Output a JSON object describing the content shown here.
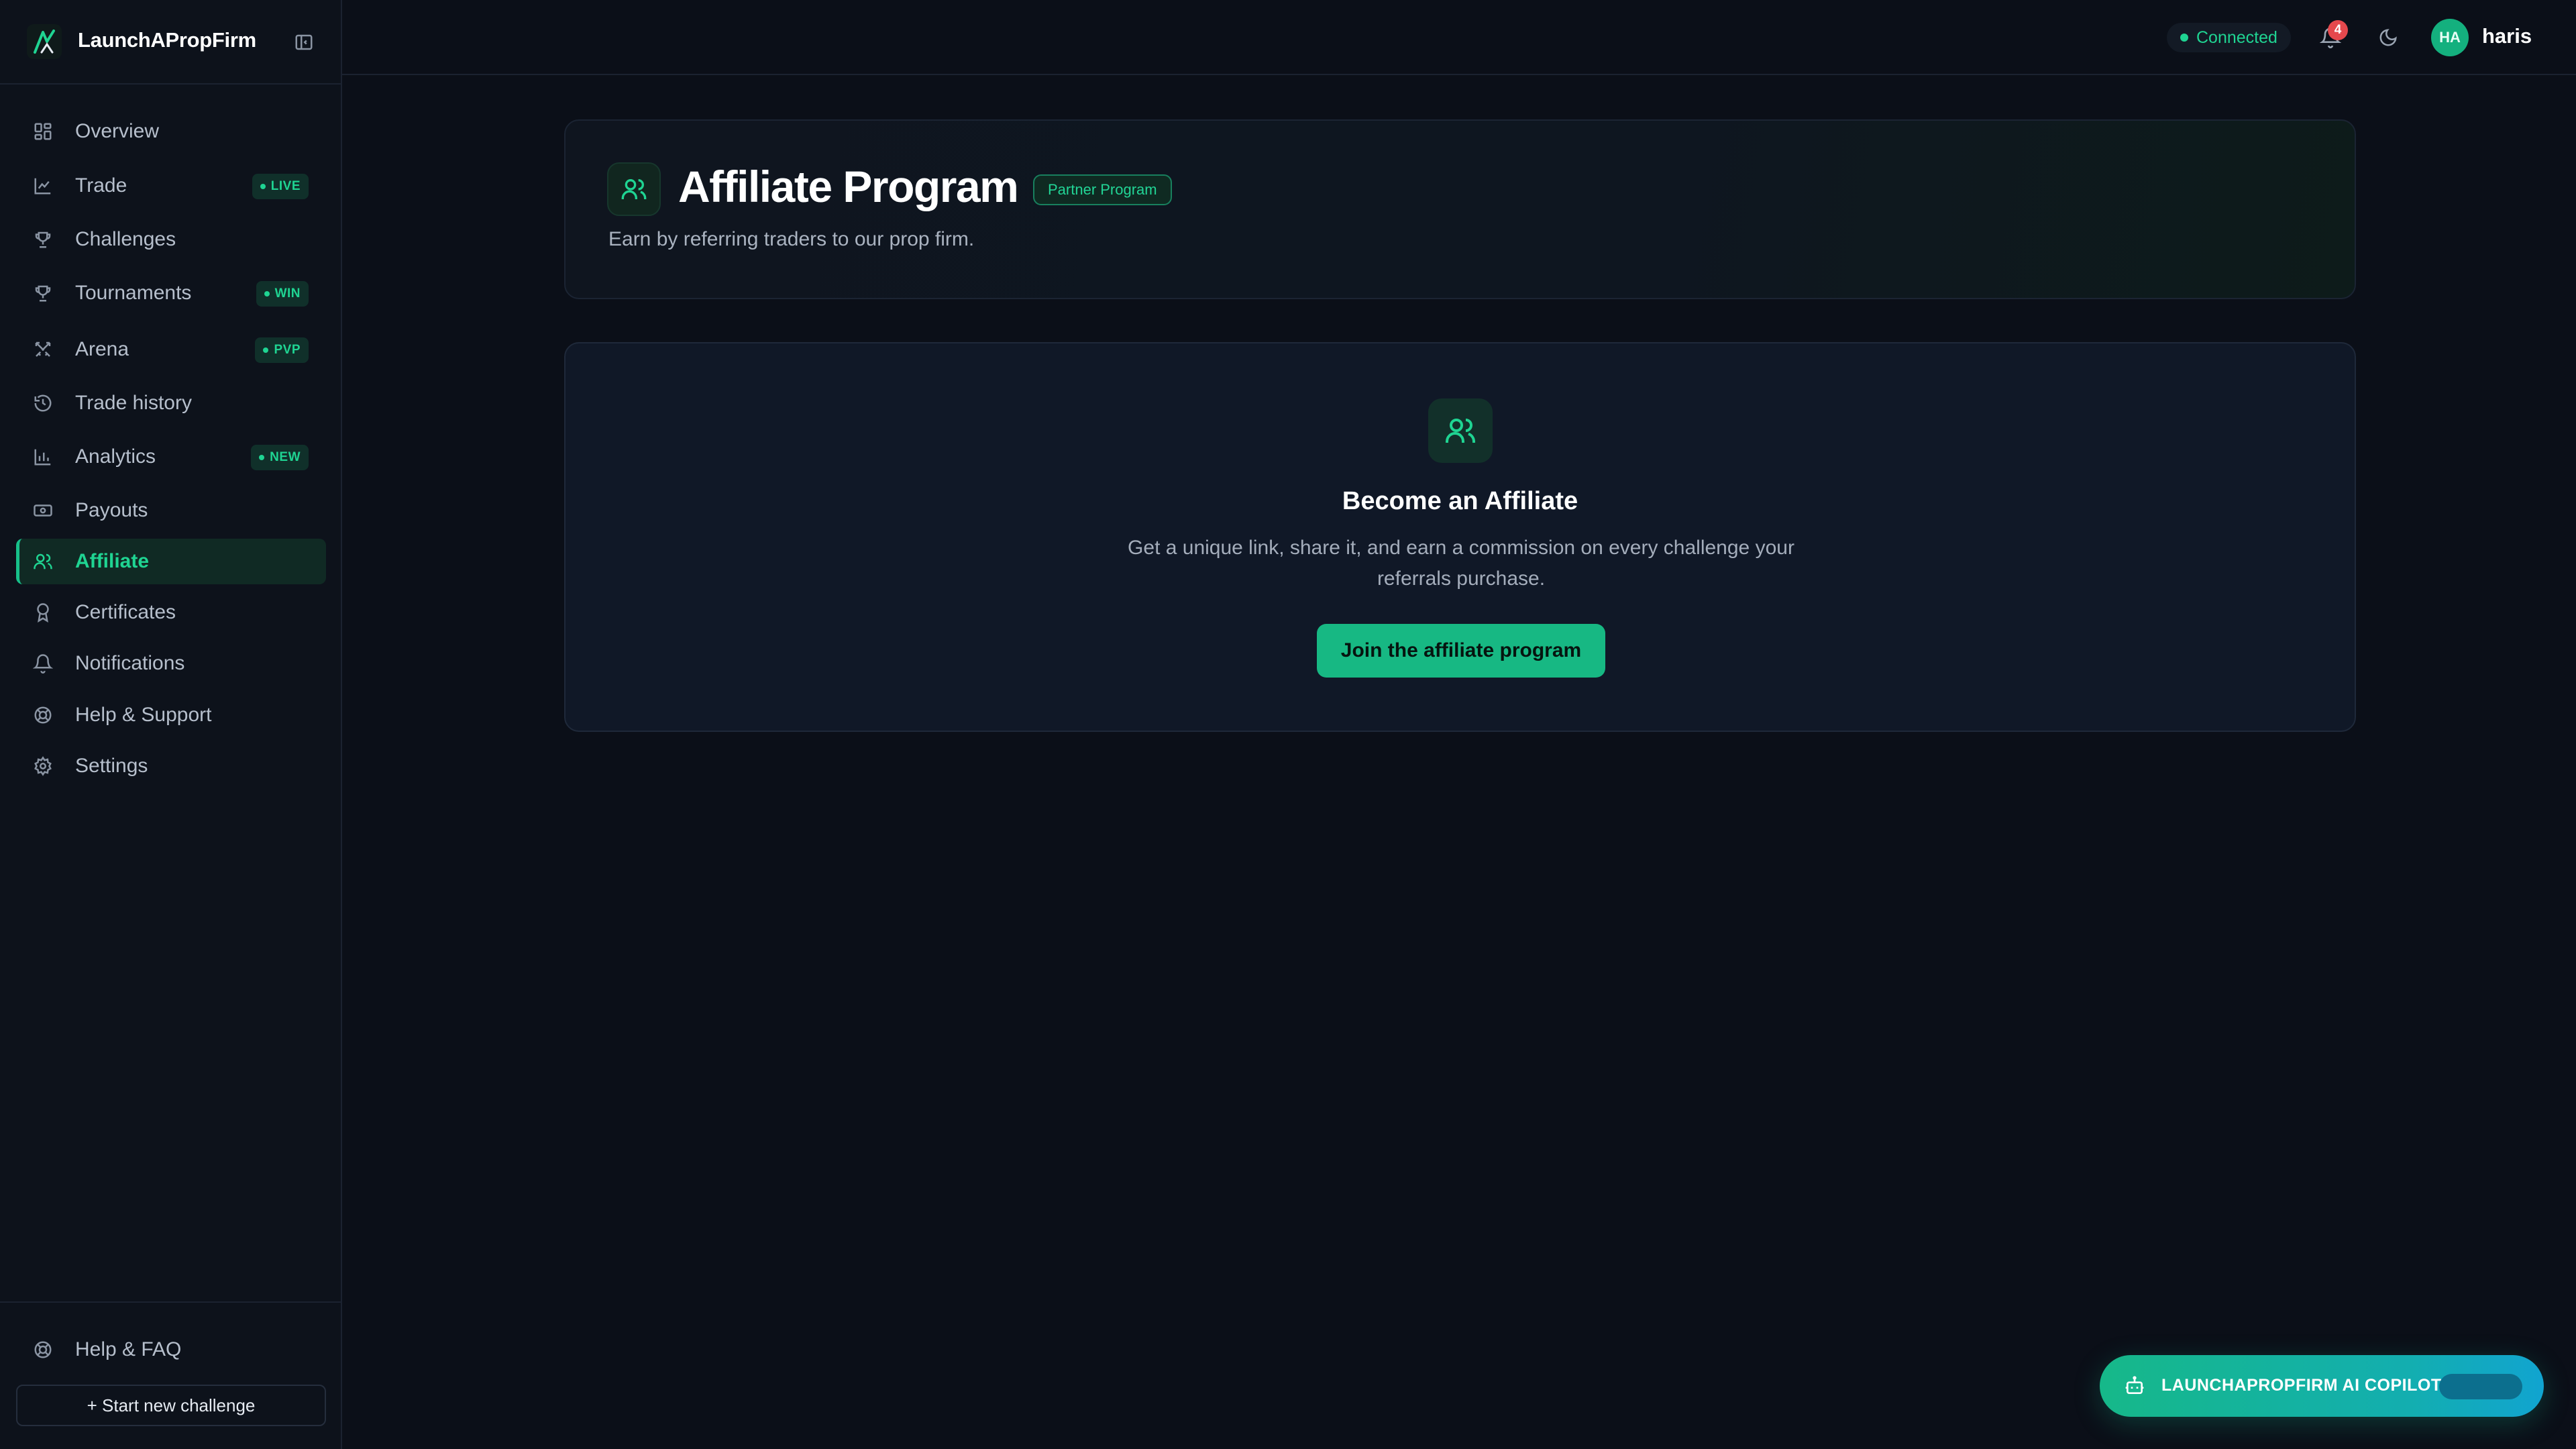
{
  "brand": {
    "name": "LaunchAPropFirm"
  },
  "sidebar": {
    "items": [
      {
        "label": "Overview",
        "icon": "grid-icon"
      },
      {
        "label": "Trade",
        "icon": "chart-line-icon",
        "badge": "LIVE"
      },
      {
        "label": "Challenges",
        "icon": "trophy-icon"
      },
      {
        "label": "Tournaments",
        "icon": "trophy-icon",
        "badge": "WIN"
      },
      {
        "label": "Arena",
        "icon": "swords-icon",
        "badge": "PVP"
      },
      {
        "label": "Trade history",
        "icon": "history-icon"
      },
      {
        "label": "Analytics",
        "icon": "bar-chart-icon",
        "badge": "NEW"
      },
      {
        "label": "Payouts",
        "icon": "banknote-icon"
      },
      {
        "label": "Affiliate",
        "icon": "users-icon",
        "active": true
      },
      {
        "label": "Certificates",
        "icon": "award-icon"
      },
      {
        "label": "Notifications",
        "icon": "bell-icon"
      },
      {
        "label": "Help & Support",
        "icon": "lifebuoy-icon"
      },
      {
        "label": "Settings",
        "icon": "gear-icon"
      }
    ],
    "bottom": {
      "help_label": "Help & FAQ",
      "start_label": "+ Start new challenge"
    }
  },
  "topbar": {
    "status": "Connected",
    "notification_count": "4",
    "user": {
      "initials": "HA",
      "name": "haris"
    }
  },
  "header": {
    "title": "Affiliate Program",
    "badge": "Partner Program",
    "subtitle": "Earn by referring traders to our prop firm."
  },
  "cta": {
    "title": "Become an Affiliate",
    "description": "Get a unique link, share it, and earn a commission on every challenge your referrals purchase.",
    "button": "Join the affiliate program"
  },
  "copilot": {
    "label": "LAUNCHAPROPFIRM AI COPILOT"
  },
  "colors": {
    "accent": "#17b883",
    "background": "#0b0f18",
    "card": "#101827"
  }
}
